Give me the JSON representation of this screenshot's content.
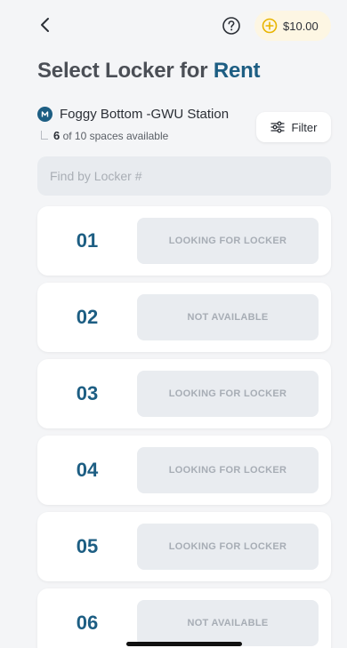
{
  "header": {
    "balance": "$10.00",
    "icons": {
      "back": "chevron-left-icon",
      "help": "question-circle-icon",
      "coin": "plus-circle-icon"
    }
  },
  "title": {
    "prefix": "Select Locker for",
    "accent": "Rent"
  },
  "station": {
    "name": "Foggy Bottom -GWU Station",
    "available_count": "6",
    "availability_suffix": "of 10 spaces available"
  },
  "filter": {
    "label": "Filter"
  },
  "search": {
    "placeholder": "Find by Locker #"
  },
  "lockers": [
    {
      "number": "01",
      "status": "LOOKING FOR LOCKER"
    },
    {
      "number": "02",
      "status": "NOT AVAILABLE"
    },
    {
      "number": "03",
      "status": "LOOKING FOR LOCKER"
    },
    {
      "number": "04",
      "status": "LOOKING FOR LOCKER"
    },
    {
      "number": "05",
      "status": "LOOKING FOR LOCKER"
    },
    {
      "number": "06",
      "status": "NOT AVAILABLE"
    }
  ],
  "colors": {
    "accent": "#1d5e83",
    "coin": "#e8b400",
    "background": "#f4f5f7"
  }
}
